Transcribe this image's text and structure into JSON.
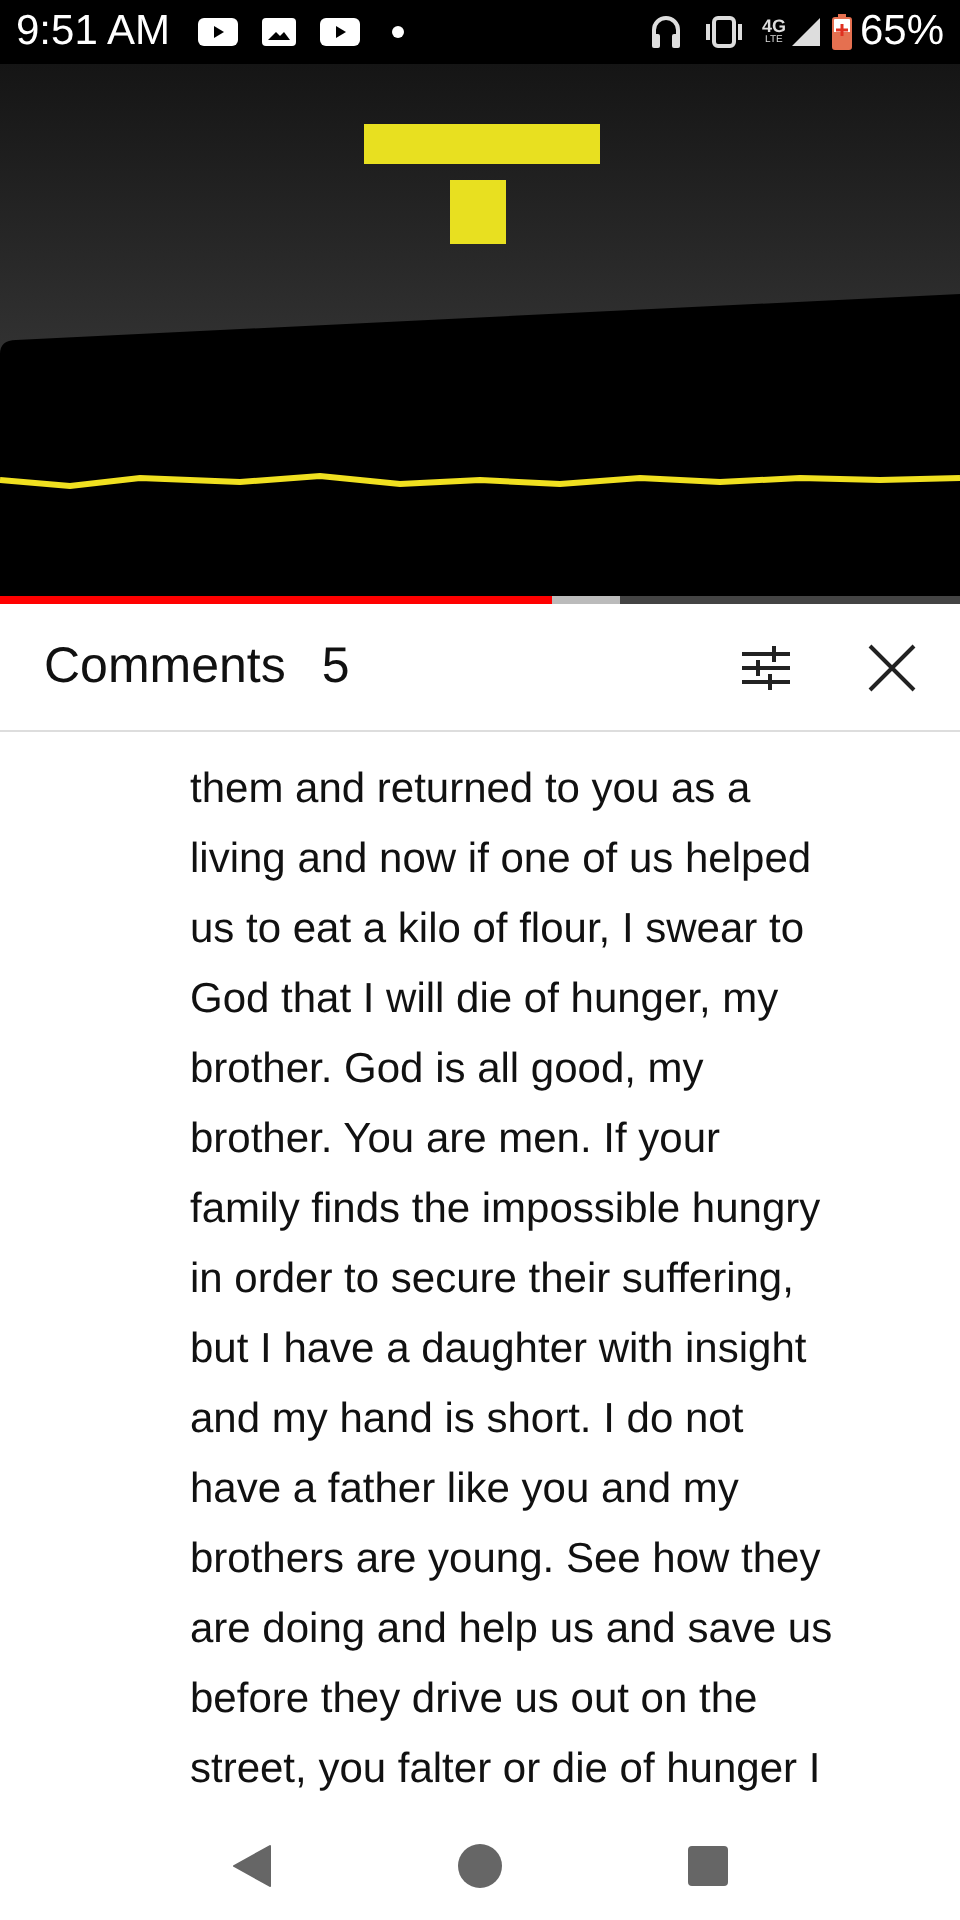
{
  "status_bar": {
    "time": "9:51 AM",
    "network": "4G",
    "network_sub": "LTE",
    "battery": "65%"
  },
  "video": {
    "progress": {
      "level": 0.575
    },
    "buffer": {
      "level": 0.646
    }
  },
  "comments_header": {
    "title": "Comments",
    "count": "5"
  },
  "comment": {
    "lines": [
      "them and returned to you as a",
      "living and now if one of us helped",
      "us to eat a kilo of flour, I swear to",
      "God that I will die of hunger, my",
      "brother. God is all good, my",
      "brother. You are men. If your",
      "family finds the impossible hungry",
      "in order to secure their suffering,",
      "but I have a daughter with insight",
      "and my hand is short. I do not",
      "have a father like you and my",
      "brothers are young. See how they",
      "are doing and help us and save us",
      "before they drive us out on the",
      "street, you falter or die of hunger I"
    ]
  }
}
